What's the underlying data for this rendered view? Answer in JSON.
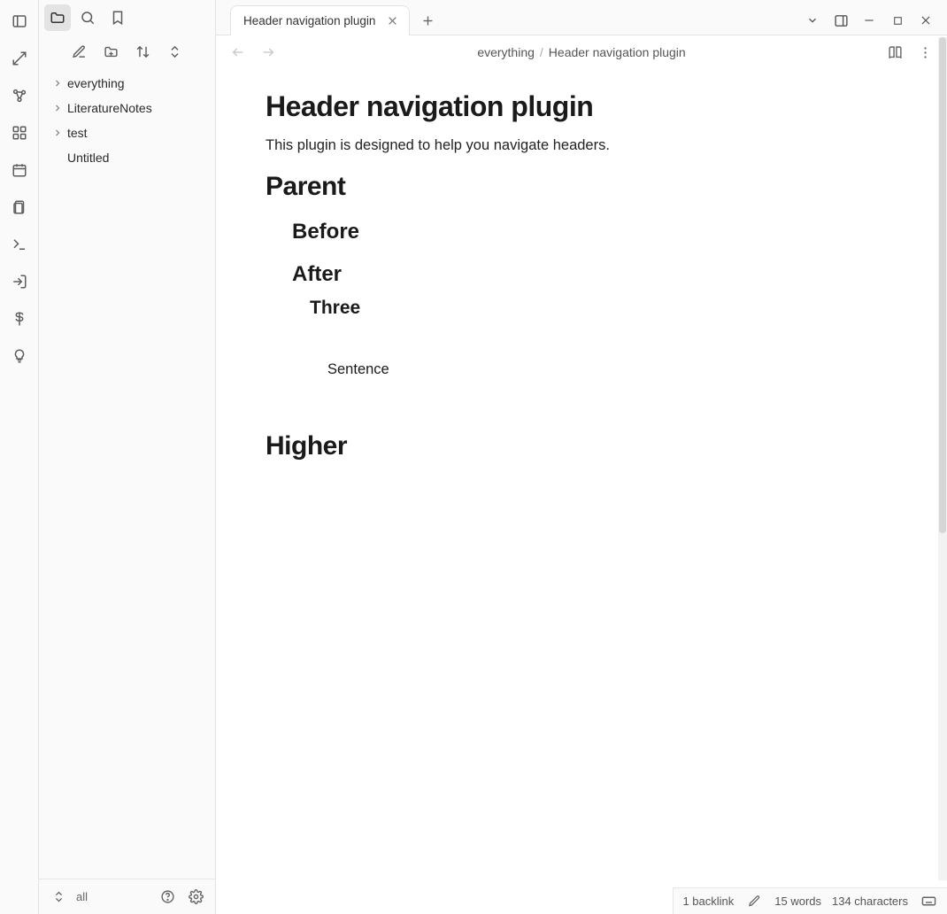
{
  "tab": {
    "title": "Header navigation plugin"
  },
  "breadcrumb": {
    "folder": "everything",
    "file": "Header navigation plugin"
  },
  "tree": {
    "items": [
      {
        "label": "everything",
        "folder": true
      },
      {
        "label": "LiteratureNotes",
        "folder": true
      },
      {
        "label": "test",
        "folder": true
      },
      {
        "label": "Untitled",
        "folder": false
      }
    ]
  },
  "sidebar_footer": {
    "label": "all"
  },
  "doc": {
    "title": "Header navigation plugin",
    "lead": "This plugin is designed to help you navigate headers.",
    "h1a": "Parent",
    "h2a": "Before",
    "h2b": "After",
    "h3a": "Three",
    "p4": "Sentence",
    "h1b": "Higher"
  },
  "status": {
    "backlinks": "1 backlink",
    "words": "15 words",
    "chars": "134 characters"
  }
}
